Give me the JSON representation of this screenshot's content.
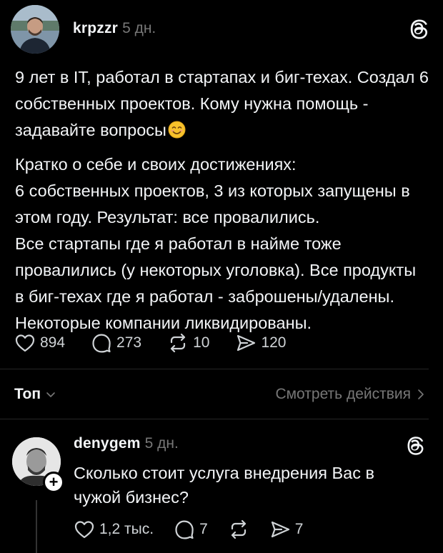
{
  "post": {
    "author": "krpzzr",
    "time": "5 дн.",
    "paragraph1": "9 лет в IT, работал в стартапах и биг-техах. Создал 6 собственных проектов. Кому нужна помощь - задавайте вопросы",
    "paragraph2": "Кратко о себе и своих достижениях:\n6 собственных проектов, 3 из которых запущены в этом году. Результат: все провалились.\nВсе стартапы где я работал в найме тоже провалились (у некоторых уголовка). Все продукты в биг-техах где я работал - заброшены/удалены. Некоторые компании ликвидированы.",
    "likes": "894",
    "comments": "273",
    "reposts": "10",
    "shares": "120"
  },
  "sort": {
    "label": "Топ",
    "see_activity": "Смотреть действия"
  },
  "reply": {
    "author": "denygem",
    "time": "5 дн.",
    "text": "Сколько стоит услуга внедрения Вас в чужой бизнес?",
    "likes": "1,2 тыс.",
    "comments": "7",
    "shares": "7"
  },
  "icons": {
    "like": "heart-icon",
    "comment": "comment-bubble-icon",
    "repost": "repost-icon",
    "share": "share-send-icon",
    "threads": "threads-logo-icon",
    "emoji": "smiling-face-emoji"
  },
  "colors": {
    "background": "#000000",
    "text": "#f3f5f7",
    "muted": "#777777",
    "divider": "#262626"
  }
}
